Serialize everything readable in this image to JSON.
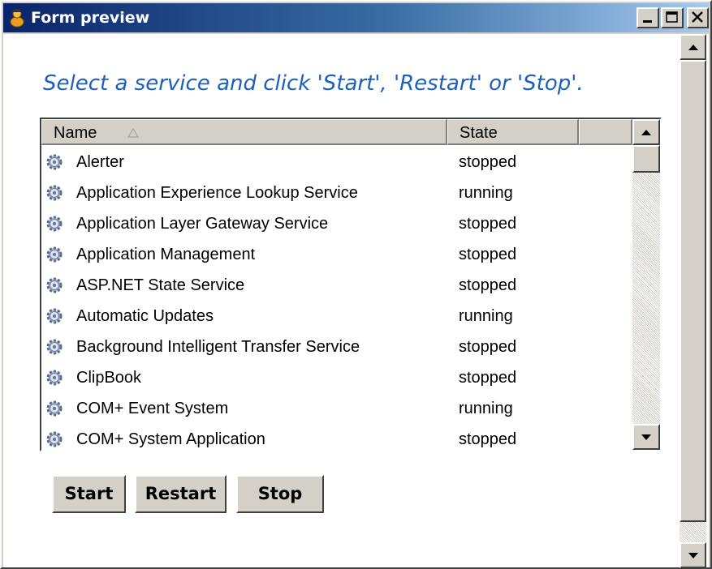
{
  "window": {
    "title": "Form preview"
  },
  "instructions": "Select a service and click 'Start', 'Restart' or 'Stop'.",
  "list": {
    "columns": [
      {
        "label": "Name",
        "sort": "ascending"
      },
      {
        "label": "State"
      }
    ],
    "rows": [
      {
        "name": "Alerter",
        "state": "stopped"
      },
      {
        "name": "Application Experience Lookup Service",
        "state": "running"
      },
      {
        "name": "Application Layer Gateway Service",
        "state": "stopped"
      },
      {
        "name": "Application Management",
        "state": "stopped"
      },
      {
        "name": "ASP.NET State Service",
        "state": "stopped"
      },
      {
        "name": "Automatic Updates",
        "state": "running"
      },
      {
        "name": "Background Intelligent Transfer Service",
        "state": "stopped"
      },
      {
        "name": "ClipBook",
        "state": "stopped"
      },
      {
        "name": "COM+ Event System",
        "state": "running"
      },
      {
        "name": "COM+ System Application",
        "state": "stopped"
      }
    ],
    "row_icon": "gear-icon"
  },
  "buttons": {
    "start": "Start",
    "restart": "Restart",
    "stop": "Stop"
  },
  "colors": {
    "title_gradient_start": "#0a246a",
    "title_gradient_end": "#a6caf0",
    "instruction_text": "#1c5fbd",
    "face": "#d4d0c8"
  }
}
